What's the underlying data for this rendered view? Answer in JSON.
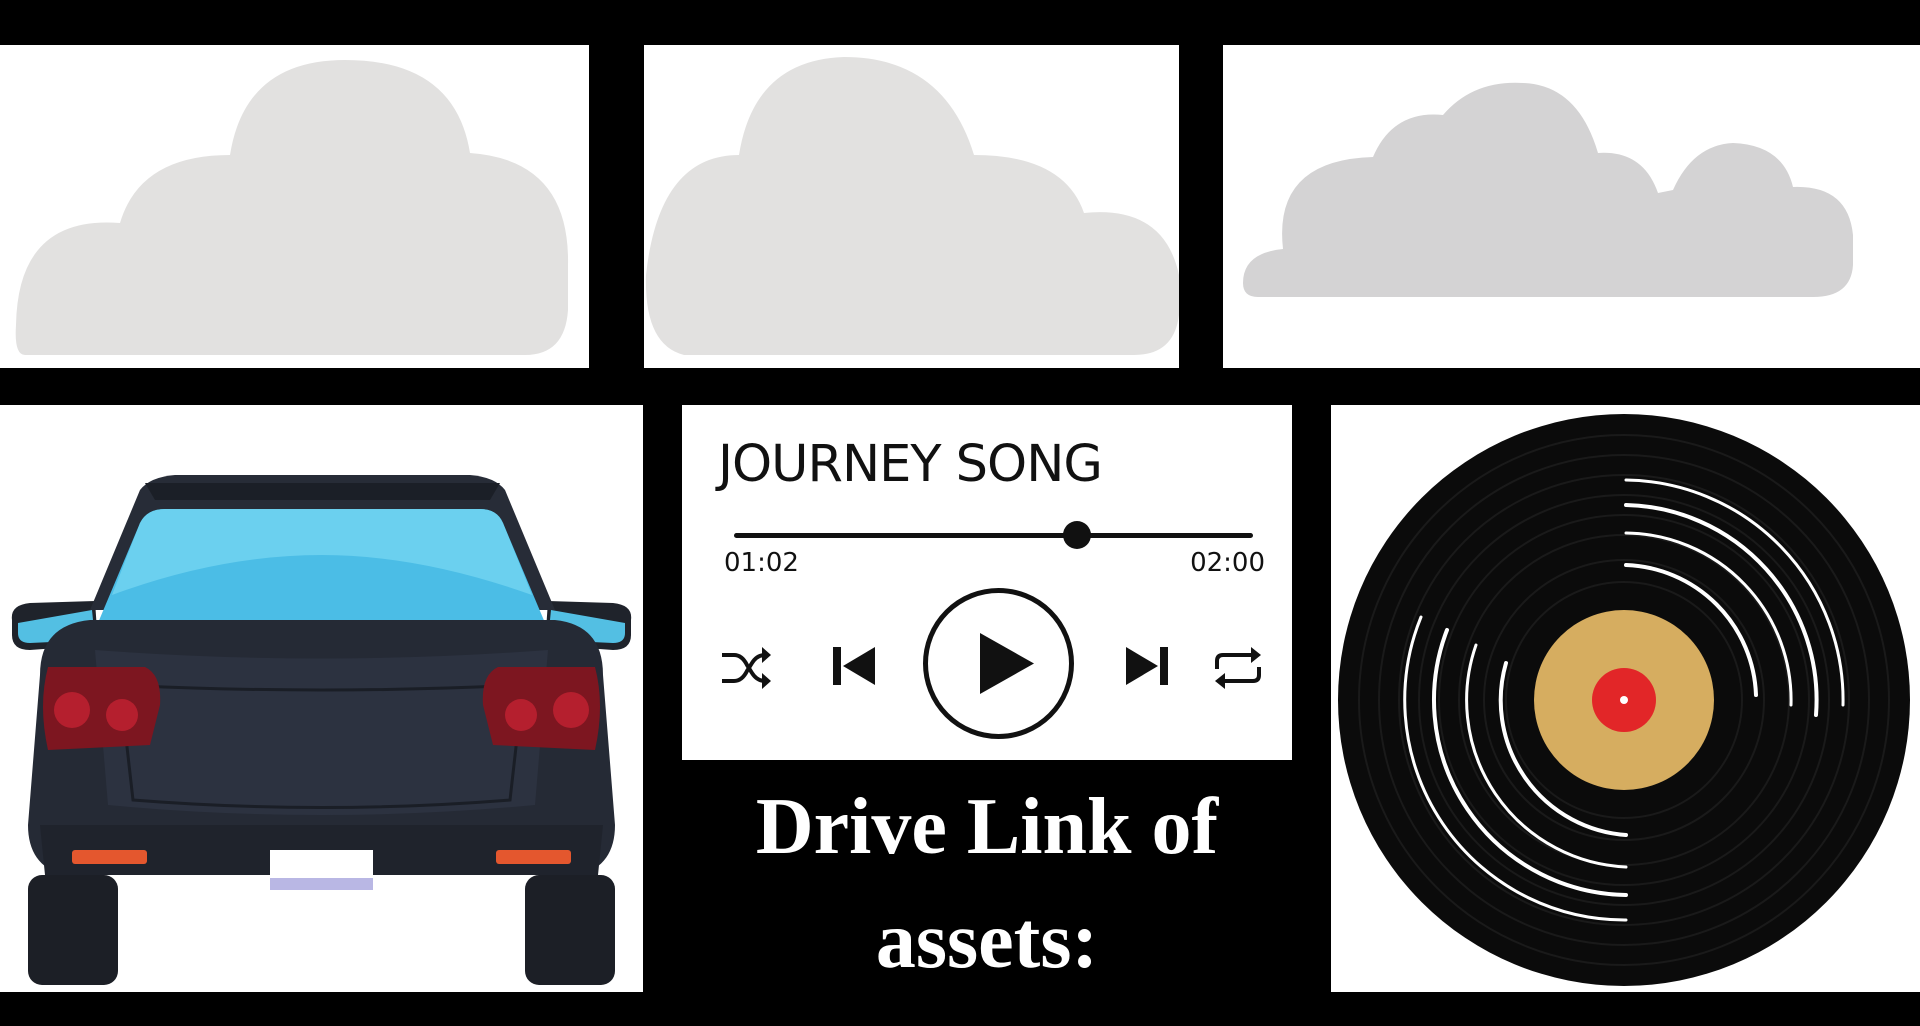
{
  "player": {
    "title": "JOURNEY SONG",
    "current_time": "01:02",
    "total_time": "02:00",
    "progress": 0.66
  },
  "caption": {
    "line1": "Drive Link of",
    "line2": "assets:"
  },
  "colors": {
    "background": "#000000",
    "cloud_light": "#e2e1e0",
    "cloud_dark": "#d4d3d4",
    "car_body": "#252a35",
    "car_glass": "#4bbde6",
    "vinyl_label": "#d6ad60",
    "vinyl_center": "#e22628"
  },
  "icons": [
    "heart-icon",
    "shuffle-icon",
    "previous-icon",
    "play-icon",
    "next-icon",
    "repeat-icon"
  ]
}
